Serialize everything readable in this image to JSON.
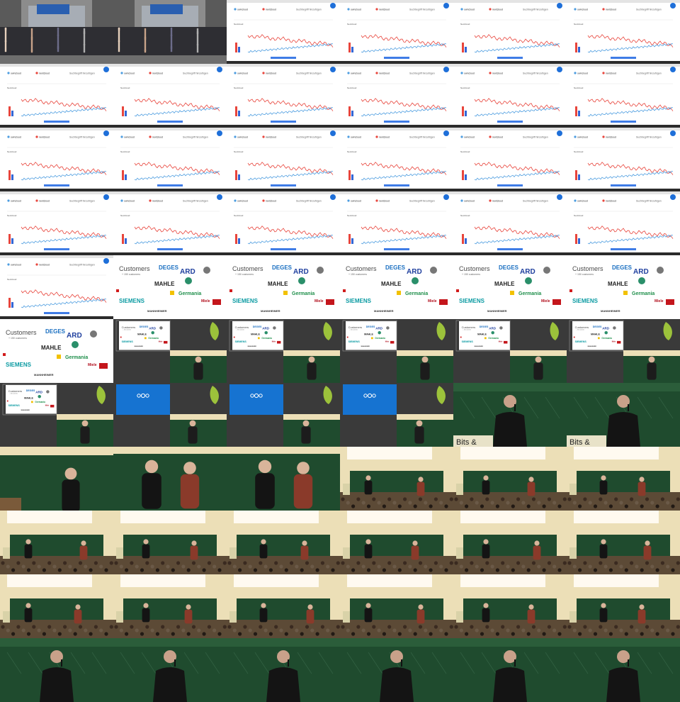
{
  "sheet": {
    "columns": 6,
    "rows": 11,
    "tile_kinds": [
      "group-photo",
      "group-photo",
      "trends",
      "trends",
      "trends",
      "trends",
      "trends",
      "trends",
      "trends",
      "trends",
      "trends",
      "trends",
      "trends",
      "trends",
      "trends",
      "trends",
      "trends",
      "trends",
      "trends",
      "trends",
      "trends",
      "trends",
      "trends",
      "trends",
      "trends",
      "customers",
      "customers",
      "customers",
      "customers",
      "customers",
      "customers",
      "talk-customers",
      "talk-customers",
      "talk-customers",
      "talk-customers",
      "talk-customers",
      "talk-customers",
      "talk-blue",
      "talk-blue",
      "talk-blue",
      "speaker-closeup",
      "speaker-closeup",
      "speaker-medium",
      "speaker-pair",
      "speaker-pair",
      "hall-wide",
      "hall-wide",
      "hall-wide",
      "hall-wide",
      "hall-wide",
      "hall-wide",
      "hall-wide",
      "hall-wide",
      "hall-wide",
      "hall-wide",
      "hall-wide",
      "hall-wide",
      "hall-wide",
      "hall-wide",
      "hall-wide",
      "speaker-closeup",
      "speaker-closeup",
      "speaker-closeup",
      "speaker-closeup",
      "speaker-closeup",
      "speaker-closeup"
    ]
  },
  "trends": {
    "legend": [
      "owncloud",
      "nextcloud",
      "Suchbegriff hinzufügen"
    ],
    "header_label": "Nextcloud",
    "footer_label": "Zuletzt aktualisiert",
    "colors": {
      "series_a": "#e8453c",
      "series_b": "#4d9de0",
      "bar_a": "#e8453c",
      "bar_b": "#3367d6",
      "footer": "#3f7ce6"
    }
  },
  "customers": {
    "title": "Customers",
    "subtitle": "+ 150 customers",
    "logos": [
      "DEGES",
      "ARD",
      "MAHLE",
      "Germania",
      "SIEMENS",
      "Miele",
      "TU",
      "MANNHEIMER",
      "Max Planck",
      "Raiffeisen"
    ],
    "colors": {
      "deges": "#1a6fc1",
      "ard": "#1f3f9e",
      "germania": "#1f8f4b",
      "siemens": "#0a9aa2",
      "miele": "#b2101e",
      "tu": "#c4161c"
    }
  },
  "stage": {
    "banner_text": "Bits &",
    "board_color": "#1f4b2e",
    "wall_color": "#ecdfb7",
    "blue_slide_color": "#1673d1",
    "logo_green": "#9cc23b"
  }
}
